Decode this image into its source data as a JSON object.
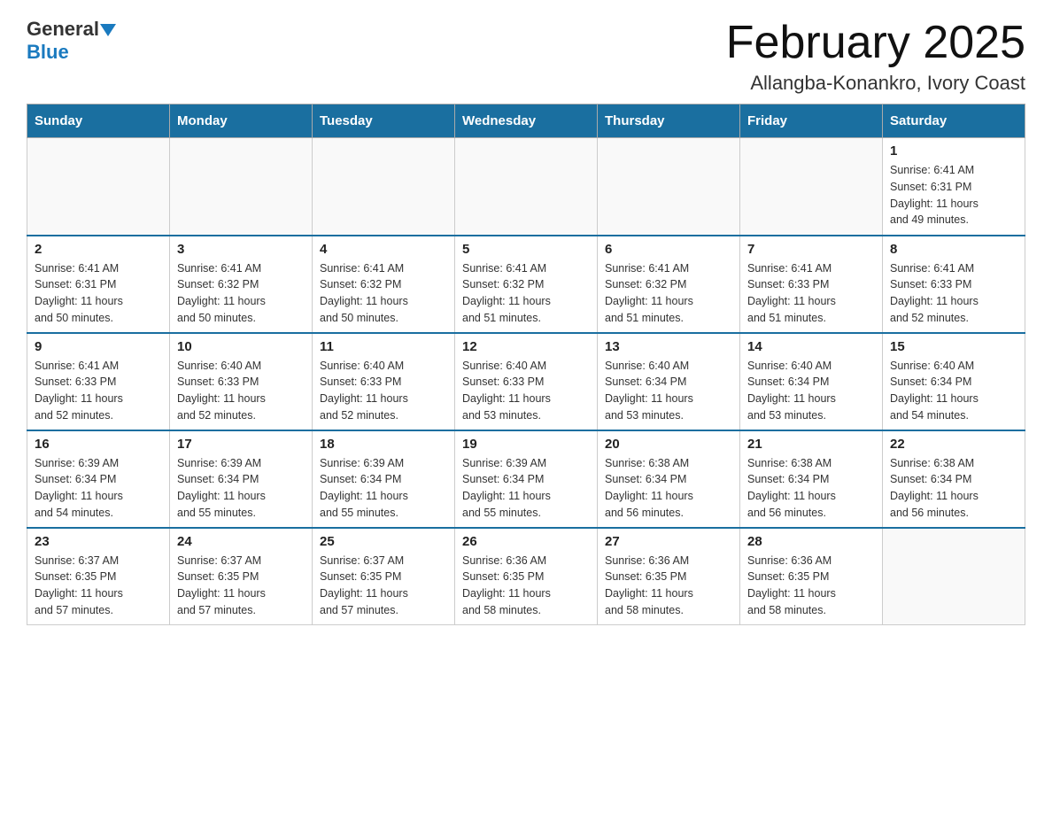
{
  "header": {
    "logo_general": "General",
    "logo_blue": "Blue",
    "month_title": "February 2025",
    "location": "Allangba-Konankro, Ivory Coast"
  },
  "weekdays": [
    "Sunday",
    "Monday",
    "Tuesday",
    "Wednesday",
    "Thursday",
    "Friday",
    "Saturday"
  ],
  "weeks": [
    {
      "days": [
        {
          "number": "",
          "info": ""
        },
        {
          "number": "",
          "info": ""
        },
        {
          "number": "",
          "info": ""
        },
        {
          "number": "",
          "info": ""
        },
        {
          "number": "",
          "info": ""
        },
        {
          "number": "",
          "info": ""
        },
        {
          "number": "1",
          "info": "Sunrise: 6:41 AM\nSunset: 6:31 PM\nDaylight: 11 hours\nand 49 minutes."
        }
      ]
    },
    {
      "days": [
        {
          "number": "2",
          "info": "Sunrise: 6:41 AM\nSunset: 6:31 PM\nDaylight: 11 hours\nand 50 minutes."
        },
        {
          "number": "3",
          "info": "Sunrise: 6:41 AM\nSunset: 6:32 PM\nDaylight: 11 hours\nand 50 minutes."
        },
        {
          "number": "4",
          "info": "Sunrise: 6:41 AM\nSunset: 6:32 PM\nDaylight: 11 hours\nand 50 minutes."
        },
        {
          "number": "5",
          "info": "Sunrise: 6:41 AM\nSunset: 6:32 PM\nDaylight: 11 hours\nand 51 minutes."
        },
        {
          "number": "6",
          "info": "Sunrise: 6:41 AM\nSunset: 6:32 PM\nDaylight: 11 hours\nand 51 minutes."
        },
        {
          "number": "7",
          "info": "Sunrise: 6:41 AM\nSunset: 6:33 PM\nDaylight: 11 hours\nand 51 minutes."
        },
        {
          "number": "8",
          "info": "Sunrise: 6:41 AM\nSunset: 6:33 PM\nDaylight: 11 hours\nand 52 minutes."
        }
      ]
    },
    {
      "days": [
        {
          "number": "9",
          "info": "Sunrise: 6:41 AM\nSunset: 6:33 PM\nDaylight: 11 hours\nand 52 minutes."
        },
        {
          "number": "10",
          "info": "Sunrise: 6:40 AM\nSunset: 6:33 PM\nDaylight: 11 hours\nand 52 minutes."
        },
        {
          "number": "11",
          "info": "Sunrise: 6:40 AM\nSunset: 6:33 PM\nDaylight: 11 hours\nand 52 minutes."
        },
        {
          "number": "12",
          "info": "Sunrise: 6:40 AM\nSunset: 6:33 PM\nDaylight: 11 hours\nand 53 minutes."
        },
        {
          "number": "13",
          "info": "Sunrise: 6:40 AM\nSunset: 6:34 PM\nDaylight: 11 hours\nand 53 minutes."
        },
        {
          "number": "14",
          "info": "Sunrise: 6:40 AM\nSunset: 6:34 PM\nDaylight: 11 hours\nand 53 minutes."
        },
        {
          "number": "15",
          "info": "Sunrise: 6:40 AM\nSunset: 6:34 PM\nDaylight: 11 hours\nand 54 minutes."
        }
      ]
    },
    {
      "days": [
        {
          "number": "16",
          "info": "Sunrise: 6:39 AM\nSunset: 6:34 PM\nDaylight: 11 hours\nand 54 minutes."
        },
        {
          "number": "17",
          "info": "Sunrise: 6:39 AM\nSunset: 6:34 PM\nDaylight: 11 hours\nand 55 minutes."
        },
        {
          "number": "18",
          "info": "Sunrise: 6:39 AM\nSunset: 6:34 PM\nDaylight: 11 hours\nand 55 minutes."
        },
        {
          "number": "19",
          "info": "Sunrise: 6:39 AM\nSunset: 6:34 PM\nDaylight: 11 hours\nand 55 minutes."
        },
        {
          "number": "20",
          "info": "Sunrise: 6:38 AM\nSunset: 6:34 PM\nDaylight: 11 hours\nand 56 minutes."
        },
        {
          "number": "21",
          "info": "Sunrise: 6:38 AM\nSunset: 6:34 PM\nDaylight: 11 hours\nand 56 minutes."
        },
        {
          "number": "22",
          "info": "Sunrise: 6:38 AM\nSunset: 6:34 PM\nDaylight: 11 hours\nand 56 minutes."
        }
      ]
    },
    {
      "days": [
        {
          "number": "23",
          "info": "Sunrise: 6:37 AM\nSunset: 6:35 PM\nDaylight: 11 hours\nand 57 minutes."
        },
        {
          "number": "24",
          "info": "Sunrise: 6:37 AM\nSunset: 6:35 PM\nDaylight: 11 hours\nand 57 minutes."
        },
        {
          "number": "25",
          "info": "Sunrise: 6:37 AM\nSunset: 6:35 PM\nDaylight: 11 hours\nand 57 minutes."
        },
        {
          "number": "26",
          "info": "Sunrise: 6:36 AM\nSunset: 6:35 PM\nDaylight: 11 hours\nand 58 minutes."
        },
        {
          "number": "27",
          "info": "Sunrise: 6:36 AM\nSunset: 6:35 PM\nDaylight: 11 hours\nand 58 minutes."
        },
        {
          "number": "28",
          "info": "Sunrise: 6:36 AM\nSunset: 6:35 PM\nDaylight: 11 hours\nand 58 minutes."
        },
        {
          "number": "",
          "info": ""
        }
      ]
    }
  ]
}
